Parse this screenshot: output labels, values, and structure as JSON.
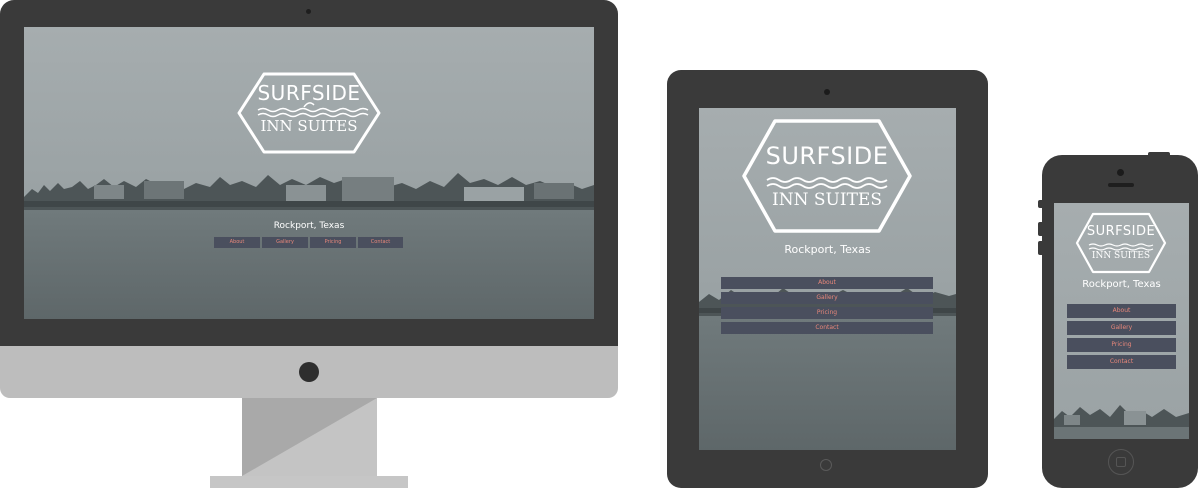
{
  "site": {
    "logo_line1": "SURFSIDE",
    "logo_line2": "INN SUITES",
    "location": "Rockport, Texas",
    "nav": [
      "About",
      "Gallery",
      "Pricing",
      "Contact"
    ]
  },
  "colors": {
    "device_frame": "#3a3a3a",
    "monitor_chin": "#bdbdbd",
    "nav_button_bg": "#4a4f5e",
    "nav_button_text": "#e8877a",
    "logo_text": "#ffffff"
  },
  "devices": [
    "desktop-monitor",
    "tablet",
    "phone"
  ],
  "icons": [
    "wave-icon",
    "dolphin-icon",
    "home-button-icon",
    "camera-icon"
  ]
}
